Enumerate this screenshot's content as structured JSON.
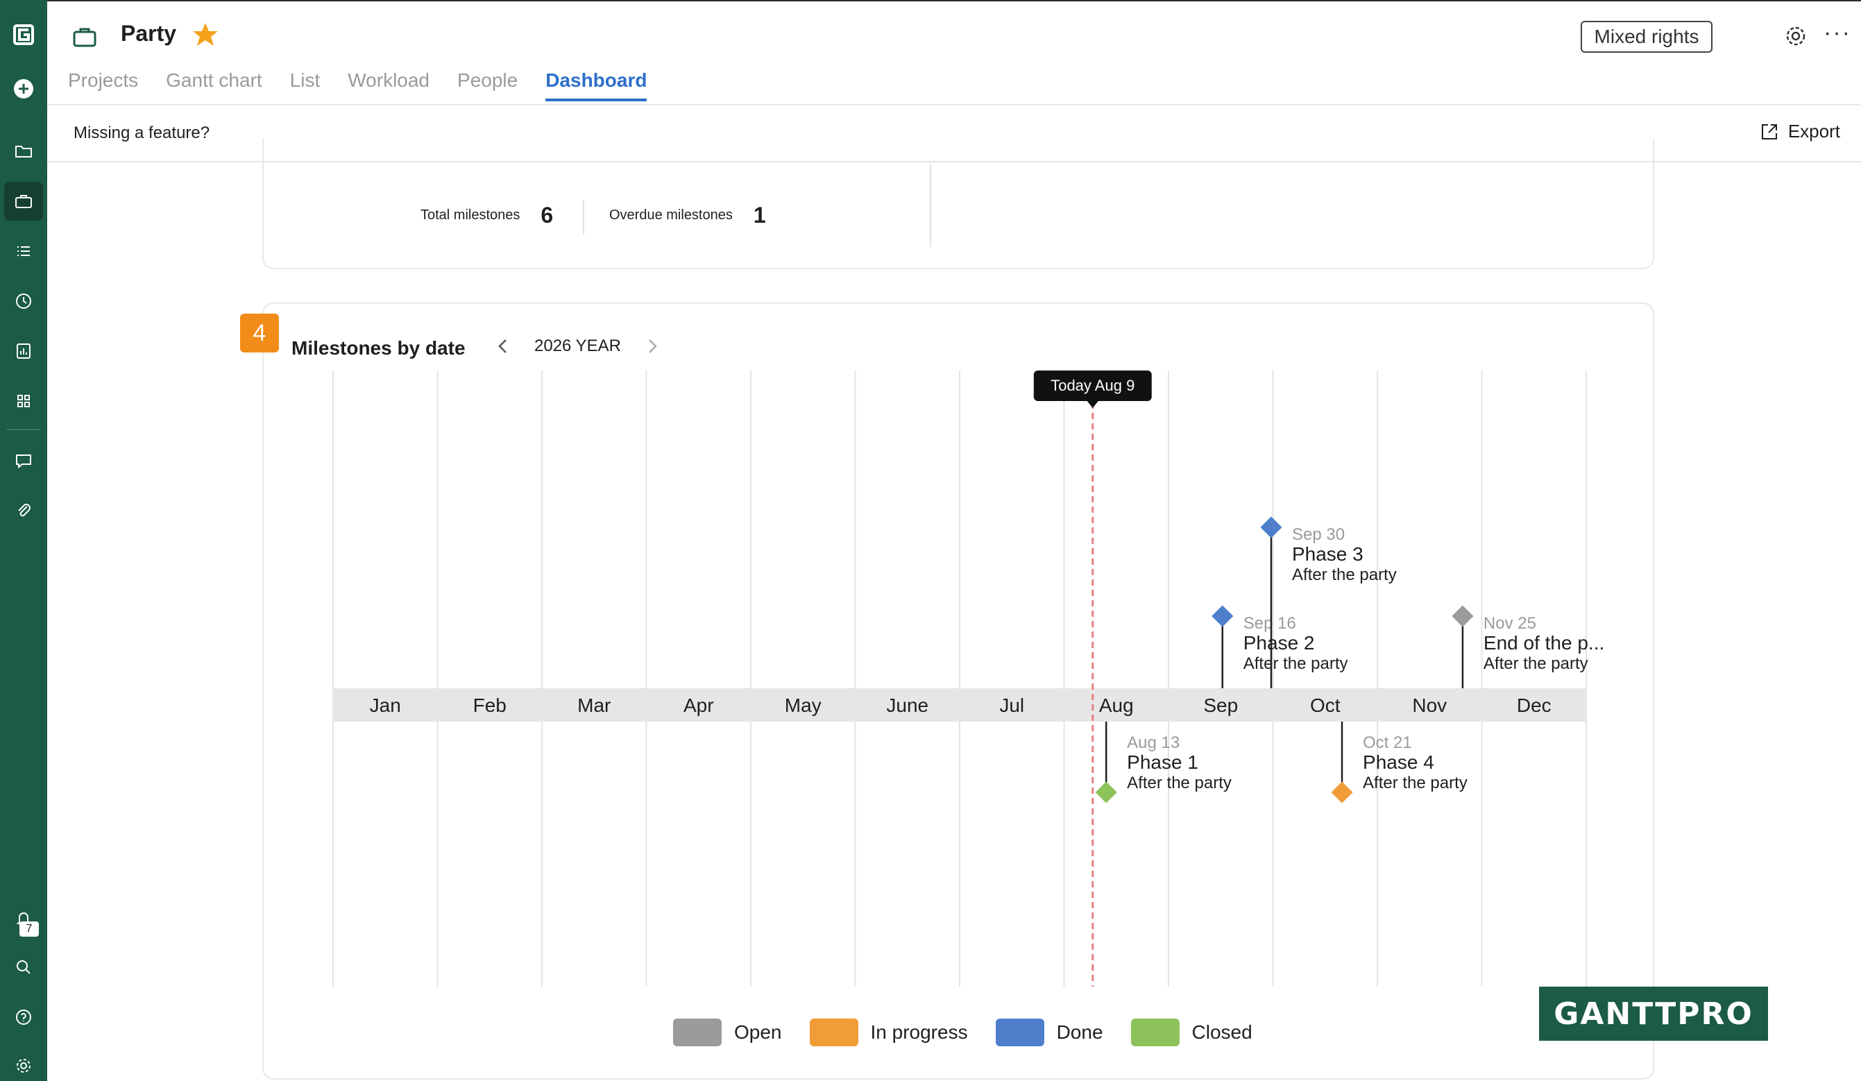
{
  "app": {
    "project_title": "Party",
    "mixed_rights": "Mixed rights",
    "tabs": [
      "Projects",
      "Gantt chart",
      "List",
      "Workload",
      "People",
      "Dashboard"
    ],
    "active_tab": "Dashboard",
    "missing_feature": "Missing a feature?",
    "export_label": "Export",
    "notification_count": "7",
    "icons": {
      "sidebar": [
        "logo-icon",
        "add-icon",
        "folder-icon",
        "briefcase-icon",
        "list-icon",
        "clock-icon",
        "report-icon",
        "apps-icon",
        "chat-icon",
        "attachment-icon",
        "bell-icon",
        "search-icon",
        "help-icon",
        "settings-icon"
      ]
    },
    "colors": {
      "sidebar": "#1c5b46",
      "accent": "#2c6fca",
      "badge": "#f28c18"
    }
  },
  "stats": {
    "total_label": "Total milestones",
    "total_value": "6",
    "overdue_label": "Overdue milestones",
    "overdue_value": "1"
  },
  "widget": {
    "number": "4",
    "title": "Milestones by date",
    "year": "2026 YEAR"
  },
  "chart_data": {
    "type": "timeline",
    "months": [
      "Jan",
      "Feb",
      "Mar",
      "Apr",
      "May",
      "June",
      "Jul",
      "Aug",
      "Sep",
      "Oct",
      "Nov",
      "Dec"
    ],
    "today_label": "Today Aug 9",
    "today": {
      "month": 8,
      "day": 9
    },
    "milestones": [
      {
        "date_label": "Aug 13",
        "month": 8,
        "day": 13,
        "name": "Phase 1",
        "subtitle": "After the party",
        "status": "Closed",
        "side": "below"
      },
      {
        "date_label": "Sep 16",
        "month": 9,
        "day": 16,
        "name": "Phase 2",
        "subtitle": "After the party",
        "status": "Done",
        "side": "above"
      },
      {
        "date_label": "Sep 30",
        "month": 9,
        "day": 30,
        "name": "Phase 3",
        "subtitle": "After the party",
        "status": "Done",
        "side": "above"
      },
      {
        "date_label": "Oct 21",
        "month": 10,
        "day": 21,
        "name": "Phase 4",
        "subtitle": "After the party",
        "status": "In progress",
        "side": "below"
      },
      {
        "date_label": "Nov 25",
        "month": 11,
        "day": 25,
        "name": "End of the p...",
        "subtitle": "After the party",
        "status": "Open",
        "side": "above"
      }
    ],
    "legend": [
      {
        "label": "Open",
        "color": "#9b9b9b"
      },
      {
        "label": "In progress",
        "color": "#f29c38"
      },
      {
        "label": "Done",
        "color": "#4f7fcb"
      },
      {
        "label": "Closed",
        "color": "#8ec25b"
      }
    ]
  },
  "brand": "GANTTPRO"
}
